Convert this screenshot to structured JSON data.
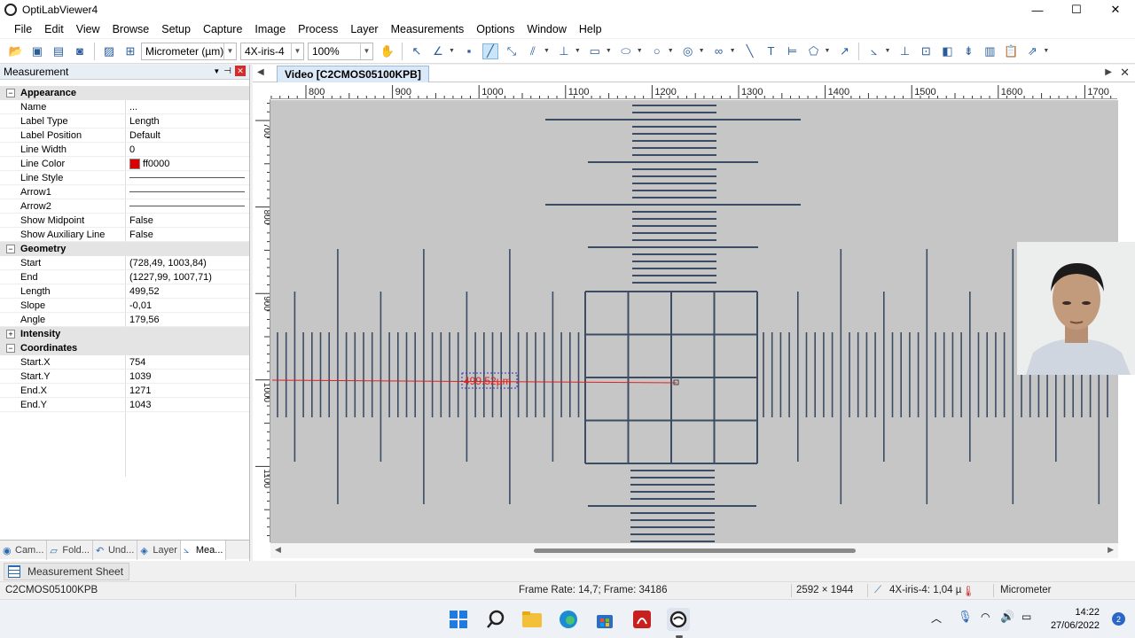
{
  "window": {
    "title": "OptiLabViewer4",
    "min": "—",
    "max": "☐",
    "close": "✕"
  },
  "menu": [
    "File",
    "Edit",
    "View",
    "Browse",
    "Setup",
    "Capture",
    "Image",
    "Process",
    "Layer",
    "Measurements",
    "Options",
    "Window",
    "Help"
  ],
  "toolbar": {
    "unit": "Micrometer (µm)",
    "objective": "4X-iris-4",
    "zoom": "100%"
  },
  "panel": {
    "title": "Measurement",
    "categories": [
      {
        "name": "Appearance",
        "rows": [
          {
            "name": "Name",
            "value": "..."
          },
          {
            "name": "Label Type",
            "value": "Length"
          },
          {
            "name": "Label Position",
            "value": "Default"
          },
          {
            "name": "Line Width",
            "value": "0"
          },
          {
            "name": "Line Color",
            "value": "ff0000",
            "color": "#dd0000"
          },
          {
            "name": "Line Style",
            "value": ""
          },
          {
            "name": "Arrow1",
            "value": ""
          },
          {
            "name": "Arrow2",
            "value": ""
          },
          {
            "name": "Show Midpoint",
            "value": "False"
          },
          {
            "name": "Show Auxiliary Line",
            "value": "False"
          }
        ]
      },
      {
        "name": "Geometry",
        "rows": [
          {
            "name": "Start",
            "value": "(728,49, 1003,84)"
          },
          {
            "name": "End",
            "value": "(1227,99, 1007,71)"
          },
          {
            "name": "Length",
            "value": "499,52"
          },
          {
            "name": "Slope",
            "value": "-0,01"
          },
          {
            "name": "Angle",
            "value": "179,56"
          }
        ]
      },
      {
        "name": "Intensity",
        "rows": []
      },
      {
        "name": "Coordinates",
        "rows": [
          {
            "name": "Start.X",
            "value": "754"
          },
          {
            "name": "Start.Y",
            "value": "1039"
          },
          {
            "name": "End.X",
            "value": "1271"
          },
          {
            "name": "End.Y",
            "value": "1043"
          }
        ]
      }
    ],
    "tabs": [
      "Cam...",
      "Fold...",
      "Und...",
      "Layer",
      "Mea..."
    ]
  },
  "document": {
    "tab": "Video [C2CMOS05100KPB]",
    "hruler_labels": [
      "800",
      "900",
      "1000",
      "1100",
      "1200",
      "1300",
      "1400",
      "1500",
      "1600",
      "1700"
    ],
    "vruler_labels": [
      "700",
      "800",
      "900",
      "1000",
      "1100"
    ],
    "measurement_label": "499.52µm"
  },
  "sheet_tab": "Measurement Sheet",
  "status": {
    "camera": "C2CMOS05100KPB",
    "frame": "Frame Rate: 14,7; Frame: 34186",
    "resolution": "2592 × 1944",
    "calibration": "4X-iris-4: 1,04 µ",
    "unit": "Micrometer"
  },
  "clock": {
    "time": "14:22",
    "date": "27/06/2022"
  },
  "notifications": "2"
}
